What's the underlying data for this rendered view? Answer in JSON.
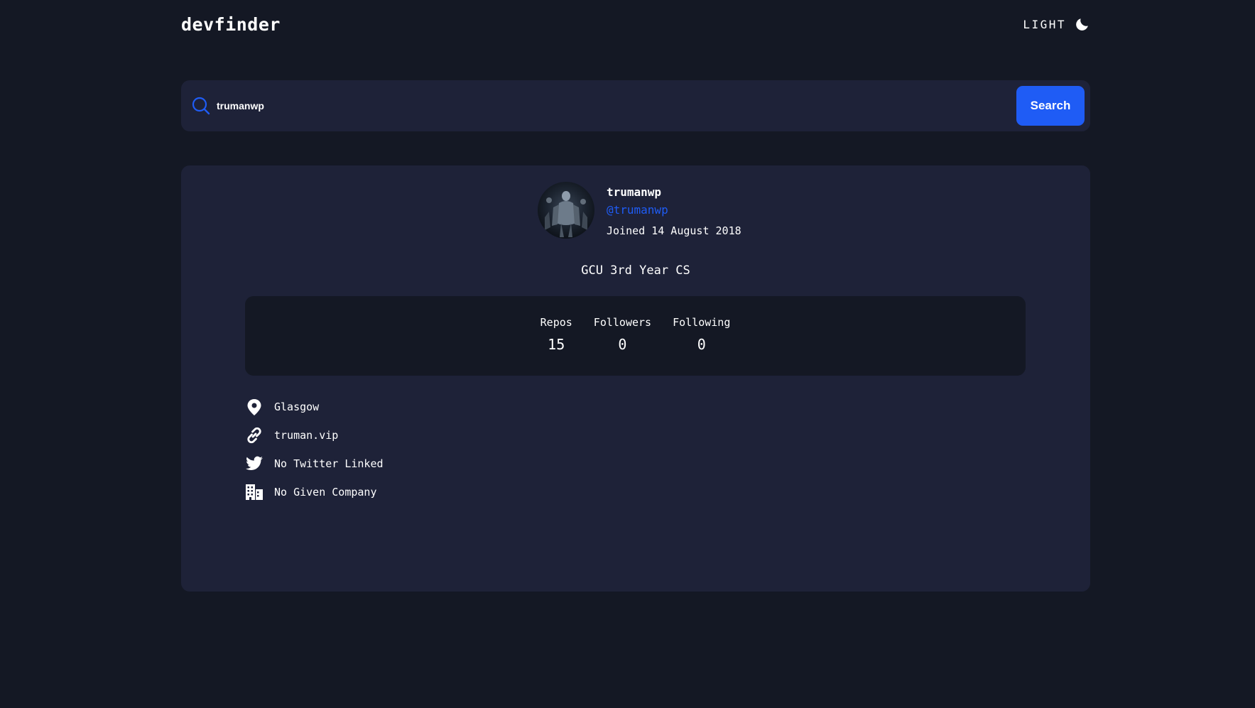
{
  "header": {
    "logo": "devfinder",
    "theme_label": "LIGHT",
    "theme_icon": "moon-icon"
  },
  "search": {
    "icon": "search-icon",
    "value": "trumanwp",
    "button_label": "Search"
  },
  "profile": {
    "avatar_icon": "avatar",
    "name": "trumanwp",
    "username": "@trumanwp",
    "joined": "Joined 14 August 2018",
    "bio": "GCU 3rd Year CS",
    "stats": {
      "repos_label": "Repos",
      "repos_value": "15",
      "followers_label": "Followers",
      "followers_value": "0",
      "following_label": "Following",
      "following_value": "0"
    },
    "links": {
      "location": "Glasgow",
      "website": "truman.vip",
      "twitter": "No Twitter Linked",
      "company": "No Given Company"
    }
  },
  "colors": {
    "background": "#141824",
    "card": "#1e2238",
    "accent": "#1f5cf5",
    "text": "#ffffff"
  }
}
